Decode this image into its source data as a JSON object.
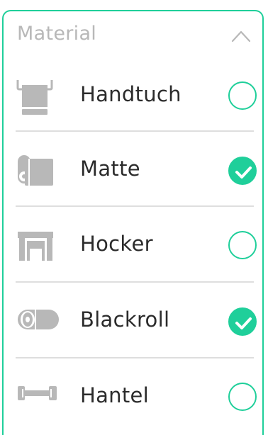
{
  "panel": {
    "title": "Material",
    "chevron_icon": "chevron-up-icon",
    "accent_color": "#1fcf9a",
    "items": [
      {
        "label": "Handtuch",
        "icon": "towel-icon",
        "checked": false
      },
      {
        "label": "Matte",
        "icon": "mat-icon",
        "checked": true
      },
      {
        "label": "Hocker",
        "icon": "stool-icon",
        "checked": false
      },
      {
        "label": "Blackroll",
        "icon": "foam-roller-icon",
        "checked": true
      },
      {
        "label": "Hantel",
        "icon": "dumbbell-icon",
        "checked": false
      }
    ]
  }
}
